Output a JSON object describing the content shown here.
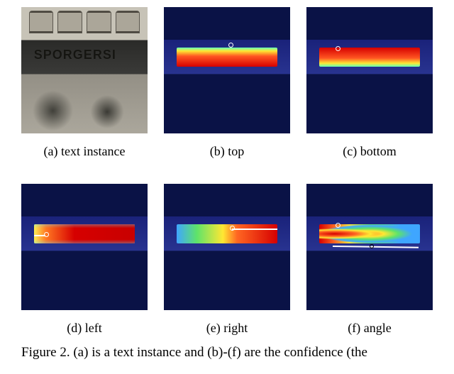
{
  "panels": {
    "a": {
      "label": "(a) text instance",
      "text": "SPORGERSI"
    },
    "b": {
      "label": "(b) top"
    },
    "c": {
      "label": "(c) bottom"
    },
    "d": {
      "label": "(d) left"
    },
    "e": {
      "label": "(e) right"
    },
    "f": {
      "label": "(f) angle"
    }
  },
  "figure_caption": "Figure 2. (a) is a text instance and (b)-(f) are the confidence (the"
}
